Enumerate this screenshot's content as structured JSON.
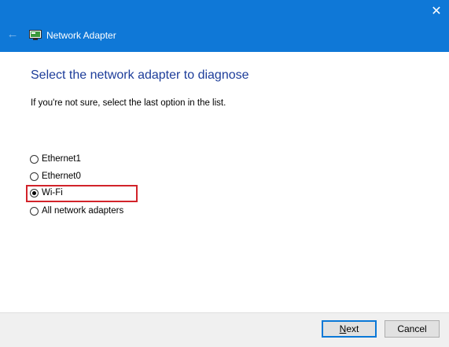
{
  "window": {
    "title": "Network Adapter",
    "close_glyph": "✕",
    "back_glyph": "←",
    "accent_color": "#0f78d7"
  },
  "main": {
    "heading": "Select the network adapter to diagnose",
    "hint": "If you're not sure, select the last option in the list.",
    "options": [
      {
        "label": "Ethernet1",
        "selected": false
      },
      {
        "label": "Ethernet0",
        "selected": false
      },
      {
        "label": "Wi-Fi",
        "selected": true
      },
      {
        "label": "All network adapters",
        "selected": false
      }
    ],
    "highlight_color": "#d2232a"
  },
  "footer": {
    "next_label_access": "N",
    "next_label_rest": "ext",
    "cancel_label": "Cancel"
  },
  "icons": {
    "back": "arrow-left",
    "app": "network-adapter",
    "close": "close-x"
  }
}
